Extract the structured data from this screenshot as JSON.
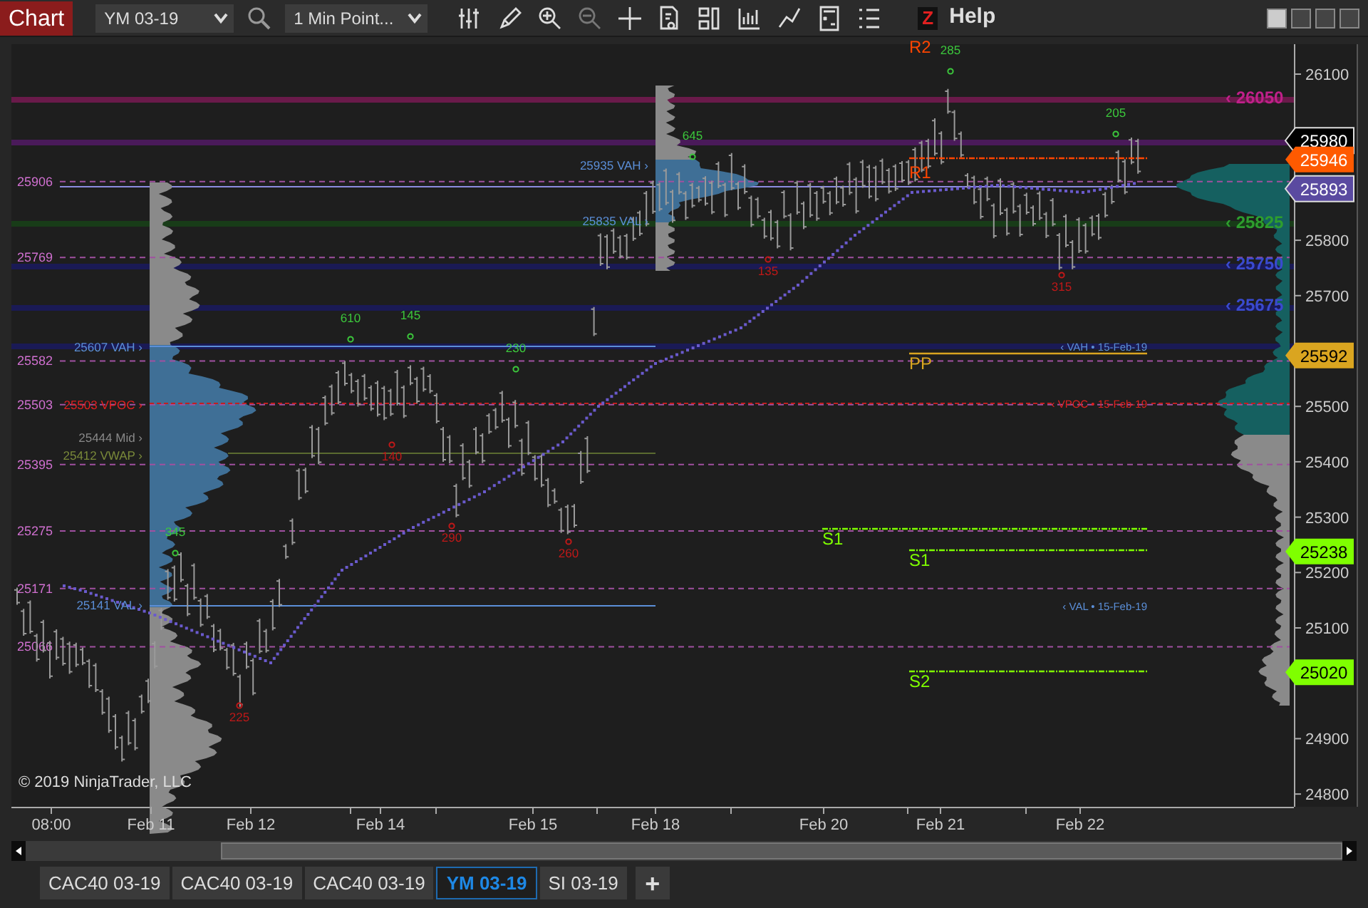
{
  "toolbar": {
    "title": "Chart",
    "instrument": "YM 03-19",
    "interval": "1 Min Point...",
    "help_key": "Z",
    "help": "Help"
  },
  "chart": {
    "y_axis_labels": [
      "26100",
      "25800",
      "25700",
      "25500",
      "25400",
      "25300",
      "25200",
      "25100",
      "24900",
      "24800"
    ],
    "x_axis_labels": [
      "08:00",
      "Feb 11",
      "Feb 12",
      "Feb 14",
      "Feb 15",
      "Feb 18",
      "Feb 20",
      "Feb 21",
      "Feb 22"
    ],
    "price_tags": [
      {
        "text": "25980",
        "color": "#000000"
      },
      {
        "text": "25946",
        "color": "#ff5a00"
      },
      {
        "text": "25893",
        "color": "#5a4aa0"
      },
      {
        "text": "25592",
        "color": "#daa520"
      },
      {
        "text": "25238",
        "color": "#7fff00"
      },
      {
        "text": "25020",
        "color": "#7fff00"
      }
    ],
    "session_levels": [
      "25906",
      "25769",
      "25582",
      "25503",
      "25395",
      "25275",
      "25171",
      "25066"
    ],
    "profile_labels": [
      {
        "text": "25935 VAH ›",
        "kind": "vah"
      },
      {
        "text": "25835 VAL ›",
        "kind": "val"
      },
      {
        "text": "25607 VAH ›",
        "kind": "vah"
      },
      {
        "text": "25503 VPOC ›",
        "kind": "vpoc"
      },
      {
        "text": "25444 Mid ›",
        "kind": "mid"
      },
      {
        "text": "25412 VWAP ›",
        "kind": "vwap"
      },
      {
        "text": "25141 VAL ›",
        "kind": "val"
      }
    ],
    "right_levels": [
      {
        "text": "‹ 26050",
        "color": "#c0208a"
      },
      {
        "text": "‹ 25825",
        "color": "#2e9e2e"
      },
      {
        "text": "‹ 25750",
        "color": "#3a4ad0"
      },
      {
        "text": "‹ 25675",
        "color": "#3a4ad0"
      }
    ],
    "prior_day": [
      {
        "text": "‹ VAH • 15-Feb-19",
        "kind": "vah"
      },
      {
        "text": "‹ VPOC • 15-Feb-19",
        "kind": "vpoc"
      },
      {
        "text": "‹ VAL • 15-Feb-19",
        "kind": "val"
      }
    ],
    "pivots": [
      {
        "text": "R2",
        "kind": "resistance"
      },
      {
        "text": "R1",
        "kind": "resistance"
      },
      {
        "text": "PP",
        "kind": "pivot"
      },
      {
        "text": "S1",
        "kind": "support"
      },
      {
        "text": "S1",
        "kind": "support"
      },
      {
        "text": "S2",
        "kind": "support"
      }
    ],
    "swings": [
      {
        "text": "645",
        "kind": "high"
      },
      {
        "text": "285",
        "kind": "high"
      },
      {
        "text": "205",
        "kind": "high"
      },
      {
        "text": "610",
        "kind": "high"
      },
      {
        "text": "145",
        "kind": "high"
      },
      {
        "text": "230",
        "kind": "high"
      },
      {
        "text": "345",
        "kind": "high"
      },
      {
        "text": "135",
        "kind": "low"
      },
      {
        "text": "315",
        "kind": "low"
      },
      {
        "text": "140",
        "kind": "low"
      },
      {
        "text": "290",
        "kind": "low"
      },
      {
        "text": "260",
        "kind": "low"
      },
      {
        "text": "225",
        "kind": "low"
      }
    ],
    "copyright": "© 2019 NinjaTrader, LLC"
  },
  "tabs": [
    {
      "label": "CAC40 03-19",
      "selected": false
    },
    {
      "label": "CAC40 03-19",
      "selected": false
    },
    {
      "label": "CAC40 03-19",
      "selected": false
    },
    {
      "label": "YM 03-19",
      "selected": true
    },
    {
      "label": "SI 03-19",
      "selected": false
    }
  ],
  "add_tab": "+"
}
